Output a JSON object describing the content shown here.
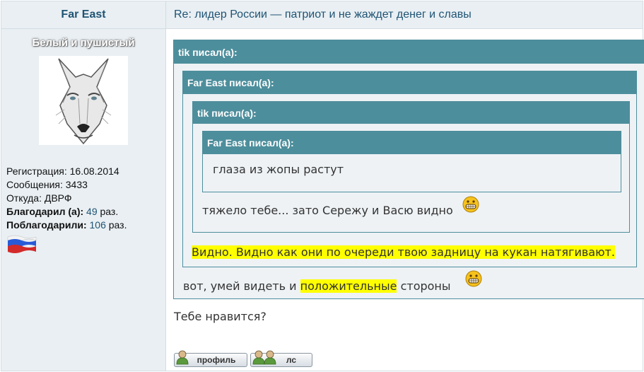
{
  "author": {
    "name": "Far East",
    "rank": "Белый и пушистый",
    "avatar_icon": "wolf-avatar",
    "registration": "Регистрация: 16.08.2014",
    "messages": "Сообщения: 3433",
    "location": "Откуда: ДВРФ",
    "thanked_label": "Благодарил (а):",
    "thanked_count": "49",
    "thanked_suffix": "раз.",
    "thanks_received_label": "Поблагодарили:",
    "thanks_received_count": "106",
    "thanks_received_suffix": "раз.",
    "flag_icon": "russia-flag-icon"
  },
  "post": {
    "subject": "Re: лидер России — патриот и не жаждет денег и славы",
    "quote1_header": "tik писал(а):",
    "quote2_header": "Far East писал(а):",
    "quote3_header": "tik писал(а):",
    "quote4_header": "Far East писал(а):",
    "quote4_text": "глаза из жопы растут",
    "quote3_text": "тяжело тебе... зато Сережу и Васю видно",
    "quote2_text": "Видно. Видно как они по очереди твою задницу на кукан натягивают.",
    "quote1_text_before": "вот, умей видеть и",
    "quote1_text_highlight": "положительные",
    "quote1_text_after": "стороны",
    "reply_text": "Тебе нравится?"
  },
  "buttons": {
    "profile_label": "профиль",
    "pm_label": "лс"
  },
  "colors": {
    "quote_header": "#4d8e9c",
    "quote_body": "#eef2f5",
    "highlight": "#ffff00",
    "link": "#1f5373"
  }
}
